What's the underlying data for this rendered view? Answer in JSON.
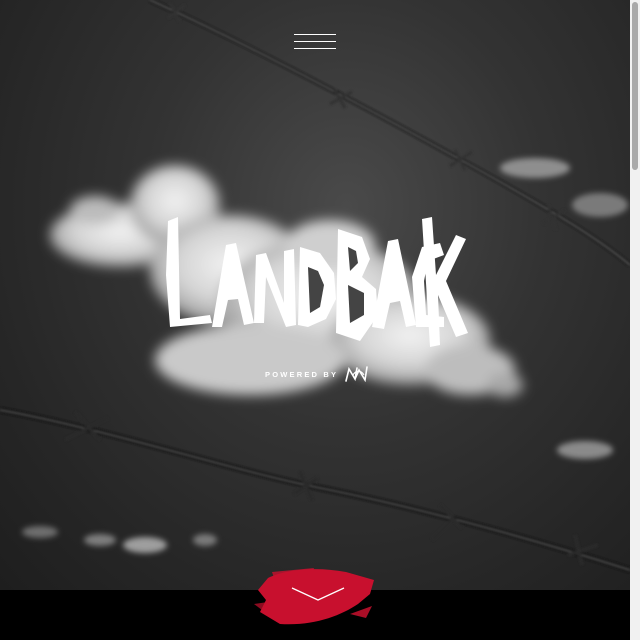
{
  "header": {
    "menu_icon": "hamburger-menu-icon"
  },
  "hero": {
    "logo_text": "LANDBACK",
    "powered_by_label": "POWERED BY",
    "partner_logo_text": "NDN",
    "background": "black-and-white sky with barbed wire and cloud"
  },
  "scroll_down": {
    "icon": "chevron-down-icon",
    "accent_color": "#c8102e"
  },
  "colors": {
    "accent": "#c8102e",
    "text": "#ffffff",
    "footer": "#000000"
  }
}
